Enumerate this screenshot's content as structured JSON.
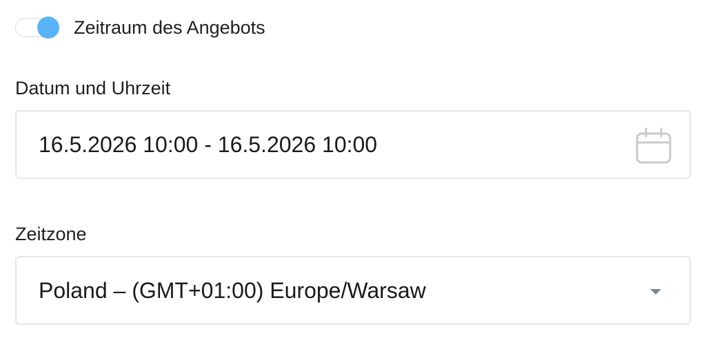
{
  "offer_period": {
    "label": "Zeitraum des Angebots",
    "enabled": true,
    "accent_color": "#58b4f7"
  },
  "date_time": {
    "label": "Datum und Uhrzeit",
    "value": "16.5.2026 10:00 - 16.5.2026 10:00",
    "icon": "calendar-icon"
  },
  "timezone": {
    "label": "Zeitzone",
    "value": "Poland – (GMT+01:00) Europe/Warsaw",
    "icon": "chevron-down-icon"
  }
}
